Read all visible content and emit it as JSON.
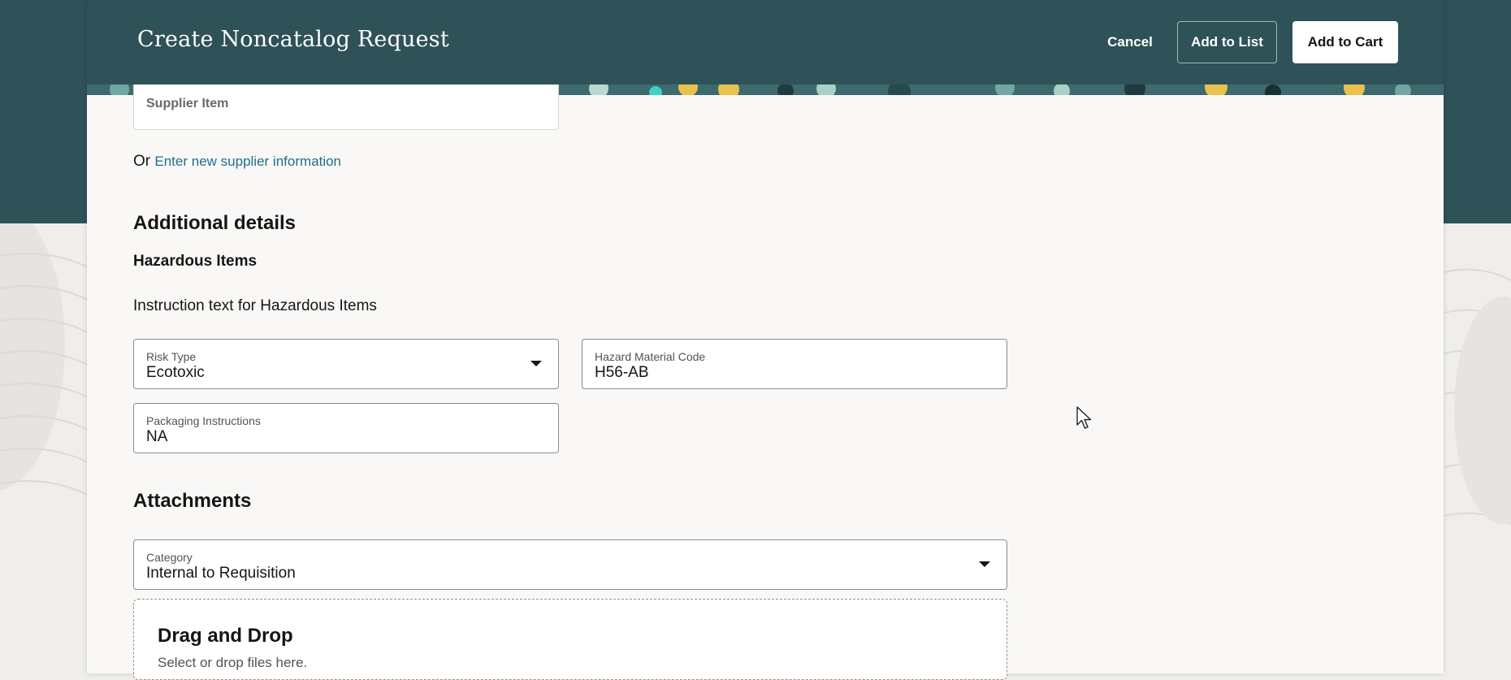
{
  "header": {
    "title": "Create Noncatalog Request",
    "cancel_label": "Cancel",
    "add_to_list_label": "Add to List",
    "add_to_cart_label": "Add to Cart"
  },
  "supplier": {
    "supplier_item_label": "Supplier Item",
    "or_text": "Or",
    "enter_new_link": "Enter new supplier information"
  },
  "additional_details": {
    "heading": "Additional details",
    "hazardous_heading": "Hazardous Items",
    "instruction": "Instruction text for Hazardous Items",
    "risk_type": {
      "label": "Risk Type",
      "value": "Ecotoxic"
    },
    "hazard_code": {
      "label": "Hazard Material Code",
      "value": "H56-AB"
    },
    "packaging": {
      "label": "Packaging Instructions",
      "value": "NA"
    }
  },
  "attachments": {
    "heading": "Attachments",
    "category": {
      "label": "Category",
      "value": "Internal to Requisition"
    },
    "drop_title": "Drag and Drop",
    "drop_subtitle": "Select or drop files here."
  },
  "colors": {
    "header_bg": "#2f5158",
    "panel_bg": "#f9f8f6",
    "link": "#1f6f8b",
    "accent_yellow": "#e8c14f"
  }
}
